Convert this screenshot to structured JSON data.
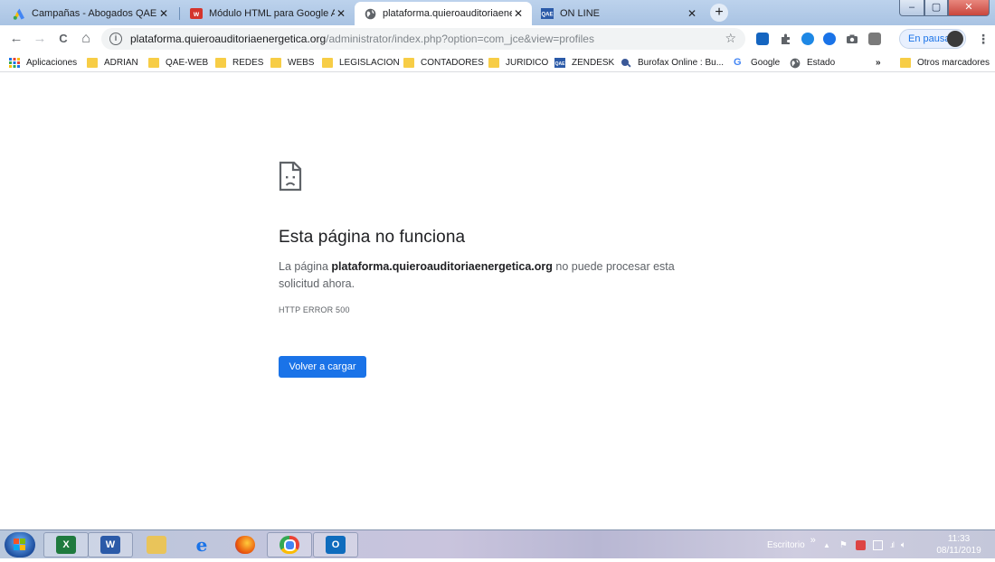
{
  "browser": {
    "tabs": [
      {
        "title": "Campañas - Abogados QAE - Go",
        "icon": "google-ads-icon",
        "close": "✕"
      },
      {
        "title": "Módulo HTML para Google Adw",
        "icon": "wix-icon",
        "close": "✕"
      },
      {
        "title": "plataforma.quieroauditoriaenerg",
        "icon": "globe-icon",
        "close": "✕"
      },
      {
        "title": "ON LINE",
        "icon": "qae-icon",
        "close": "✕"
      }
    ],
    "new_tab": "+",
    "window_controls": {
      "minimize": "–",
      "maximize": "▢",
      "close": "✕"
    },
    "nav": {
      "back": "←",
      "forward": "→",
      "reload": "C",
      "home": "⌂"
    },
    "address": {
      "host": "plataforma.quieroauditoriaenergetica.org",
      "path": "/administrator/index.php?option=com_jce&view=profiles",
      "info": "i",
      "star": "☆"
    },
    "profile_button": "En pausa",
    "menu": "⋮"
  },
  "bookmarks": [
    {
      "label": "Aplicaciones",
      "icon": "apps-grid-icon"
    },
    {
      "label": "ADRIAN",
      "icon": "folder-icon"
    },
    {
      "label": "QAE-WEB",
      "icon": "folder-icon"
    },
    {
      "label": "REDES",
      "icon": "folder-icon"
    },
    {
      "label": "WEBS",
      "icon": "folder-icon"
    },
    {
      "label": "LEGISLACION",
      "icon": "folder-icon"
    },
    {
      "label": "CONTADORES",
      "icon": "folder-icon"
    },
    {
      "label": "JURIDICO",
      "icon": "folder-icon"
    },
    {
      "label": "ZENDESK",
      "icon": "qae-icon"
    },
    {
      "label": "Burofax Online : Bu...",
      "icon": "burofax-icon"
    },
    {
      "label": "Google",
      "icon": "google-icon"
    },
    {
      "label": "Estado",
      "icon": "globe-icon"
    },
    {
      "label": "»",
      "icon": ""
    },
    {
      "label": "Otros marcadores",
      "icon": "folder-icon"
    }
  ],
  "error": {
    "title": "Esta página no funciona",
    "desc_prefix": "La página ",
    "desc_host": "plataforma.quieroauditoriaenergetica.org",
    "desc_suffix": " no puede procesar esta solicitud ahora.",
    "code": "HTTP ERROR 500",
    "button": "Volver a cargar"
  },
  "taskbar": {
    "apps": [
      "excel-icon",
      "word-icon",
      "file-explorer-icon",
      "internet-explorer-icon",
      "firefox-icon",
      "chrome-icon",
      "outlook-icon"
    ],
    "desktop_label": "Escritorio",
    "tray_expand": "»",
    "time": "11:33",
    "date": "08/11/2019"
  },
  "colors": {
    "accent": "#1a73e8",
    "tab_strip": "#bcd2ec",
    "folder": "#f7cd46",
    "window_close": "#c9463d"
  }
}
